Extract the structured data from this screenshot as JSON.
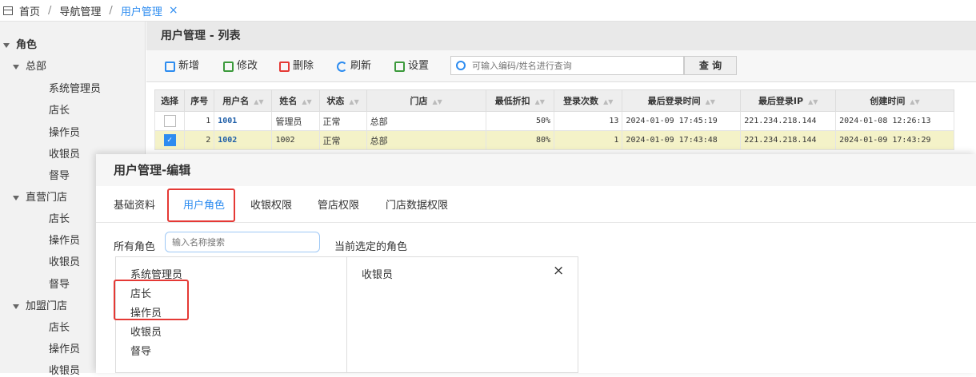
{
  "breadcrumb": {
    "home": "首页",
    "nav": "导航管理",
    "current": "用户管理",
    "close": "×",
    "sep": "/"
  },
  "sidebar": {
    "groups": [
      {
        "label": "角色",
        "level": 0
      },
      {
        "label": "总部",
        "level": 1
      },
      {
        "label": "系统管理员",
        "level": 2
      },
      {
        "label": "店长",
        "level": 2
      },
      {
        "label": "操作员",
        "level": 2
      },
      {
        "label": "收银员",
        "level": 2
      },
      {
        "label": "督导",
        "level": 2
      },
      {
        "label": "直营门店",
        "level": 1
      },
      {
        "label": "店长",
        "level": 2
      },
      {
        "label": "操作员",
        "level": 2
      },
      {
        "label": "收银员",
        "level": 2
      },
      {
        "label": "督导",
        "level": 2
      },
      {
        "label": "加盟门店",
        "level": 1
      },
      {
        "label": "店长",
        "level": 2
      },
      {
        "label": "操作员",
        "level": 2
      },
      {
        "label": "收银员",
        "level": 2
      }
    ]
  },
  "list": {
    "title": "用户管理 - 列表",
    "toolbar": {
      "add": "新增",
      "edit": "修改",
      "delete": "删除",
      "refresh": "刷新",
      "settings": "设置",
      "search_placeholder": "可输入编码/姓名进行查询",
      "query": "查 询"
    },
    "columns": [
      "选择",
      "序号",
      "用户名",
      "姓名",
      "状态",
      "门店",
      "最低折扣",
      "登录次数",
      "最后登录时间",
      "最后登录IP",
      "创建时间"
    ],
    "rows": [
      {
        "seq": "1",
        "username": "1001",
        "name": "管理员",
        "status": "正常",
        "store": "总部",
        "discount": "50%",
        "logins": "13",
        "last_login": "2024-01-09 17:45:19",
        "ip": "221.234.218.144",
        "created": "2024-01-08 12:26:13",
        "checked": false
      },
      {
        "seq": "2",
        "username": "1002",
        "name": "1002",
        "status": "正常",
        "store": "总部",
        "discount": "80%",
        "logins": "1",
        "last_login": "2024-01-09 17:43:48",
        "ip": "221.234.218.144",
        "created": "2024-01-09 17:43:29",
        "checked": true
      }
    ]
  },
  "dialog": {
    "title": "用户管理-编辑",
    "tabs": [
      "基础资料",
      "用户角色",
      "收银权限",
      "管店权限",
      "门店数据权限"
    ],
    "active_tab": "用户角色",
    "all_roles_label": "所有角色",
    "role_search_placeholder": "输入名称搜索",
    "current_label": "当前选定的角色",
    "all_roles": [
      "系统管理员",
      "店长",
      "操作员",
      "收银员",
      "督导"
    ],
    "selected_roles": [
      {
        "label": "收银员",
        "remove": "×"
      }
    ]
  },
  "colors": {
    "accent": "#2d8cf0",
    "highlight_box": "#e53935",
    "selected_row": "#f4f2c8"
  }
}
